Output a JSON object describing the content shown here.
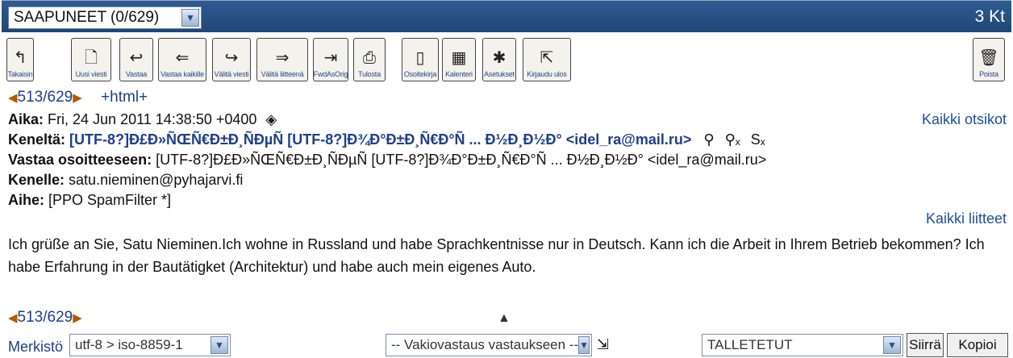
{
  "folder": {
    "selected": "SAAPUNEET (0/629)",
    "size": "3 Kt"
  },
  "toolbar": [
    {
      "label": "Takaisin",
      "icon": "↰",
      "icon_name": "back-icon"
    },
    {
      "label": "Uusi viesti",
      "icon": "🗋",
      "icon_name": "new-message-icon"
    },
    {
      "label": "Vastaa",
      "icon": "↩",
      "icon_name": "reply-icon"
    },
    {
      "label": "Vastaa kaikille",
      "icon": "⇐",
      "icon_name": "reply-all-icon"
    },
    {
      "label": "Välitä viesti",
      "icon": "↪",
      "icon_name": "forward-icon"
    },
    {
      "label": "Välitä liitteenä",
      "icon": "⇒",
      "icon_name": "forward-attachment-icon"
    },
    {
      "label": "FwdAsOrig",
      "icon": "⇥",
      "icon_name": "forward-original-icon"
    },
    {
      "label": "Tulosta",
      "icon": "⎙",
      "icon_name": "print-icon"
    },
    {
      "label": "Osoitekirja",
      "icon": "▯",
      "icon_name": "address-book-icon"
    },
    {
      "label": "Kalenteri",
      "icon": "▦",
      "icon_name": "calendar-icon"
    },
    {
      "label": "Asetukset",
      "icon": "✱",
      "icon_name": "settings-icon"
    },
    {
      "label": "Kirjaudu ulos",
      "icon": "⇱",
      "icon_name": "logout-icon"
    }
  ],
  "delete_button": {
    "label": "Poista",
    "icon": "🗑",
    "icon_name": "trash-icon"
  },
  "nav": {
    "counter": "513/629",
    "html_link": "+html+"
  },
  "headers": {
    "date_label": "Aika:",
    "date_value": "Fri, 24 Jun 2011 14:38:50 +0400",
    "from_label": "Keneltä:",
    "from_value": "[UTF-8?]Ð£Ð»ÑŒÑ€Ð±Ð¸ÑÐµÑ [UTF-8?]Ð¾Ð°Ð±Ð¸Ñ€Ð°Ñ ... Ð½Ð¸Ð½Ð° <idel_ra@mail.ru>",
    "reply_to_label": "Vastaa osoitteeseen:",
    "reply_to_value": "[UTF-8?]Ð£Ð»ÑŒÑ€Ð±Ð¸ÑÐµÑ [UTF-8?]Ð¾Ð°Ð±Ð¸Ñ€Ð°Ñ ... Ð½Ð¸Ð½Ð° <idel_ra@mail.ru>",
    "to_label": "Kenelle:",
    "to_value": "satu.nieminen@pyhajarvi.fi",
    "subject_label": "Aihe:",
    "subject_value": "[PPO SpamFilter *]",
    "all_headers_link": "Kaikki otsikot",
    "all_attachments_link": "Kaikki liitteet"
  },
  "body": "Ich grüße an Sie, Satu Nieminen.Ich wohne in Russland und habe Sprachkentnisse nur in Deutsch. Kann ich die Arbeit in Ihrem Betrieb bekommen? Ich habe Erfahrung in der Bautätigket (Architektur) und habe auch mein eigenes Auto.",
  "bottom": {
    "charset_label": "Merkistö",
    "charset_value": "utf-8 > iso-8859-1",
    "quick_reply": "-- Vakiovastaus vastaukseen --",
    "target_folder": "TALLETETUT",
    "move_label": "Siirrä",
    "copy_label": "Kopioi"
  },
  "colors": {
    "topbar": "#1f4677",
    "link": "#1d3f8a",
    "accent_arrow": "#b35b00"
  }
}
